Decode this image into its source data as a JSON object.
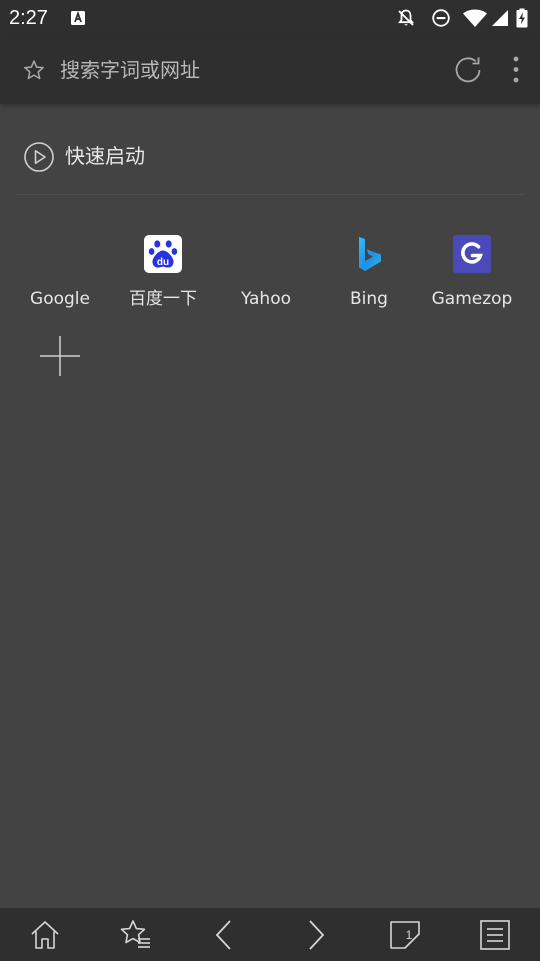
{
  "status_bar": {
    "time": "2:27",
    "icons": [
      "a-notification-icon",
      "bell-off-icon",
      "do-not-disturb-icon",
      "wifi-icon",
      "cell-signal-icon",
      "battery-charging-icon"
    ]
  },
  "address_bar": {
    "placeholder": "搜索字词或网址",
    "icons": [
      "star-icon",
      "reload-icon",
      "more-vert-icon"
    ]
  },
  "quick_launch": {
    "title": "快速启动",
    "icon": "play-circle-icon",
    "sites": [
      {
        "label": "Google",
        "icon": "google-icon"
      },
      {
        "label": "百度一下",
        "icon": "baidu-icon"
      },
      {
        "label": "Yahoo",
        "icon": "yahoo-icon"
      },
      {
        "label": "Bing",
        "icon": "bing-icon"
      },
      {
        "label": "Gamezop",
        "icon": "gamezop-icon"
      }
    ],
    "add_icon": "plus-icon"
  },
  "bottom_nav": {
    "items": [
      "home-icon",
      "bookmarks-icon",
      "back-icon",
      "forward-icon",
      "tabs-icon",
      "menu-icon"
    ],
    "tab_count": "1"
  },
  "colors": {
    "background": "#434343",
    "bars": "#2f2f2f",
    "baidu_blue": "#2932e1",
    "gamezop_purple": "#4a4ab8",
    "bing_blue": "#1fa4e6"
  }
}
